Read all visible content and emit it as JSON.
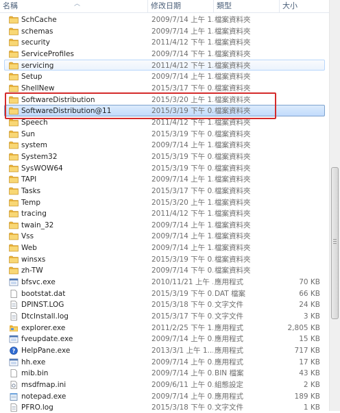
{
  "header": {
    "name": "名稱",
    "date": "修改日期",
    "type": "類型",
    "size": "大小"
  },
  "rows": [
    {
      "icon": "folder",
      "name": "SchCache",
      "date": "2009/7/14 上午 1...",
      "type": "檔案資料夾",
      "size": ""
    },
    {
      "icon": "folder",
      "name": "schemas",
      "date": "2009/7/14 上午 1...",
      "type": "檔案資料夾",
      "size": ""
    },
    {
      "icon": "folder",
      "name": "security",
      "date": "2011/4/12 下午 1...",
      "type": "檔案資料夾",
      "size": ""
    },
    {
      "icon": "folder",
      "name": "ServiceProfiles",
      "date": "2009/7/14 下午 1...",
      "type": "檔案資料夾",
      "size": ""
    },
    {
      "icon": "folder",
      "name": "servicing",
      "date": "2011/4/12 下午 1...",
      "type": "檔案資料夾",
      "size": "",
      "state": "hover"
    },
    {
      "icon": "folder",
      "name": "Setup",
      "date": "2009/7/14 上午 1...",
      "type": "檔案資料夾",
      "size": ""
    },
    {
      "icon": "folder",
      "name": "ShellNew",
      "date": "2015/3/17 下午 0...",
      "type": "檔案資料夾",
      "size": ""
    },
    {
      "icon": "folder",
      "name": "SoftwareDistribution",
      "date": "2015/3/20 上午 1...",
      "type": "檔案資料夾",
      "size": ""
    },
    {
      "icon": "folder",
      "name": "SoftwareDistribution@11",
      "date": "2015/3/19 下午 0...",
      "type": "檔案資料夾",
      "size": "",
      "state": "selected"
    },
    {
      "icon": "folder",
      "name": "Speech",
      "date": "2011/4/12 下午 1...",
      "type": "檔案資料夾",
      "size": ""
    },
    {
      "icon": "folder",
      "name": "Sun",
      "date": "2015/3/19 下午 0...",
      "type": "檔案資料夾",
      "size": ""
    },
    {
      "icon": "folder",
      "name": "system",
      "date": "2009/7/14 上午 1...",
      "type": "檔案資料夾",
      "size": ""
    },
    {
      "icon": "folder",
      "name": "System32",
      "date": "2015/3/19 下午 0...",
      "type": "檔案資料夾",
      "size": ""
    },
    {
      "icon": "folder",
      "name": "SysWOW64",
      "date": "2015/3/19 下午 0...",
      "type": "檔案資料夾",
      "size": ""
    },
    {
      "icon": "folder",
      "name": "TAPI",
      "date": "2009/7/14 上午 1...",
      "type": "檔案資料夾",
      "size": ""
    },
    {
      "icon": "folder",
      "name": "Tasks",
      "date": "2015/3/17 下午 0...",
      "type": "檔案資料夾",
      "size": ""
    },
    {
      "icon": "folder",
      "name": "Temp",
      "date": "2015/3/20 上午 1...",
      "type": "檔案資料夾",
      "size": ""
    },
    {
      "icon": "folder",
      "name": "tracing",
      "date": "2011/4/12 下午 1...",
      "type": "檔案資料夾",
      "size": ""
    },
    {
      "icon": "folder",
      "name": "twain_32",
      "date": "2009/7/14 上午 1...",
      "type": "檔案資料夾",
      "size": ""
    },
    {
      "icon": "folder",
      "name": "Vss",
      "date": "2009/7/14 上午 1...",
      "type": "檔案資料夾",
      "size": ""
    },
    {
      "icon": "folder",
      "name": "Web",
      "date": "2009/7/14 上午 1...",
      "type": "檔案資料夾",
      "size": ""
    },
    {
      "icon": "folder",
      "name": "winsxs",
      "date": "2015/3/19 下午 0...",
      "type": "檔案資料夾",
      "size": ""
    },
    {
      "icon": "folder",
      "name": "zh-TW",
      "date": "2009/7/14 下午 0...",
      "type": "檔案資料夾",
      "size": ""
    },
    {
      "icon": "exe",
      "name": "bfsvc.exe",
      "date": "2010/11/21 上午 ...",
      "type": "應用程式",
      "size": "70 KB"
    },
    {
      "icon": "file",
      "name": "bootstat.dat",
      "date": "2015/3/19 下午 0...",
      "type": "DAT 檔案",
      "size": "66 KB"
    },
    {
      "icon": "log",
      "name": "DPINST.LOG",
      "date": "2015/3/18 下午 0...",
      "type": "文字文件",
      "size": "24 KB"
    },
    {
      "icon": "log",
      "name": "DtcInstall.log",
      "date": "2015/3/17 下午 0...",
      "type": "文字文件",
      "size": "3 KB"
    },
    {
      "icon": "explorer",
      "name": "explorer.exe",
      "date": "2011/2/25 下午 1...",
      "type": "應用程式",
      "size": "2,805 KB"
    },
    {
      "icon": "exe",
      "name": "fveupdate.exe",
      "date": "2009/7/14 上午 0...",
      "type": "應用程式",
      "size": "15 KB"
    },
    {
      "icon": "help",
      "name": "HelpPane.exe",
      "date": "2013/3/1 上午 1...",
      "type": "應用程式",
      "size": "717 KB"
    },
    {
      "icon": "exe",
      "name": "hh.exe",
      "date": "2009/7/14 上午 0...",
      "type": "應用程式",
      "size": "17 KB"
    },
    {
      "icon": "file",
      "name": "mib.bin",
      "date": "2009/7/14 上午 0...",
      "type": "BIN 檔案",
      "size": "43 KB"
    },
    {
      "icon": "ini",
      "name": "msdfmap.ini",
      "date": "2009/6/11 上午 0...",
      "type": "組態設定",
      "size": "2 KB"
    },
    {
      "icon": "notepad",
      "name": "notepad.exe",
      "date": "2009/7/14 上午 0...",
      "type": "應用程式",
      "size": "189 KB"
    },
    {
      "icon": "log",
      "name": "PFRO.log",
      "date": "2015/3/18 下午 0...",
      "type": "文字文件",
      "size": "1 KB"
    }
  ]
}
